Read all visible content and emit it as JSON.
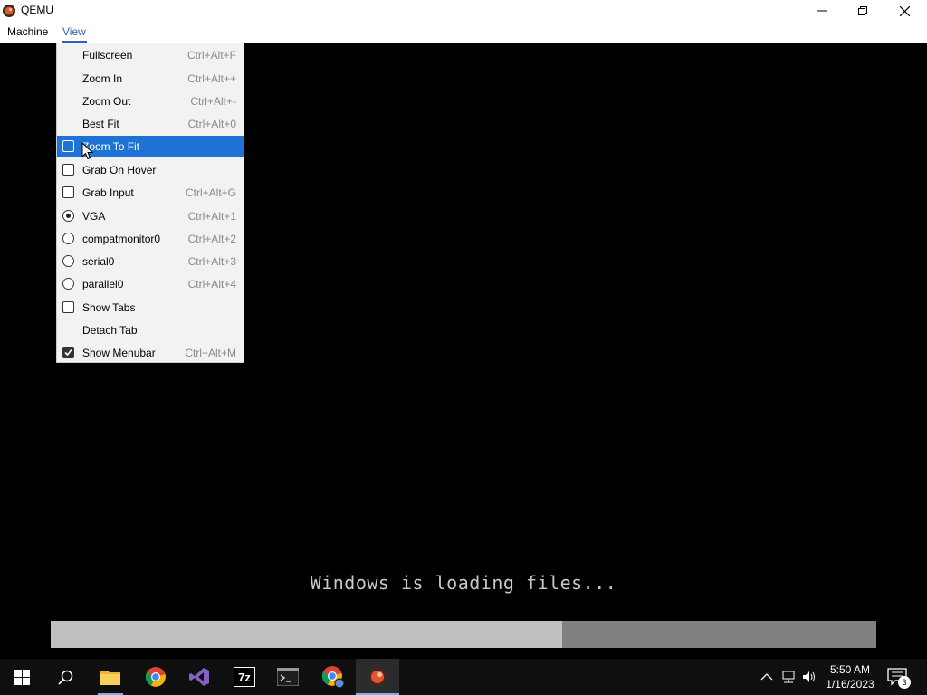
{
  "window": {
    "title": "QEMU",
    "app_icon": "qemu-icon",
    "controls": [
      "minimize-icon",
      "restore-icon",
      "close-icon"
    ]
  },
  "menubar": {
    "items": [
      {
        "label": "Machine"
      },
      {
        "label": "View",
        "active": true
      }
    ]
  },
  "view_menu": {
    "items": [
      {
        "label": "Fullscreen",
        "shortcut": "Ctrl+Alt+F",
        "indicator": "none"
      },
      {
        "label": "Zoom In",
        "shortcut": "Ctrl+Alt++",
        "indicator": "none"
      },
      {
        "label": "Zoom Out",
        "shortcut": "Ctrl+Alt+-",
        "indicator": "none"
      },
      {
        "label": "Best Fit",
        "shortcut": "Ctrl+Alt+0",
        "indicator": "none"
      },
      {
        "label": "Zoom To Fit",
        "shortcut": "",
        "indicator": "checkbox",
        "checked": false,
        "highlighted": true
      },
      {
        "label": "Grab On Hover",
        "shortcut": "",
        "indicator": "checkbox",
        "checked": false
      },
      {
        "label": "Grab Input",
        "shortcut": "Ctrl+Alt+G",
        "indicator": "checkbox",
        "checked": false
      },
      {
        "label": "VGA",
        "shortcut": "Ctrl+Alt+1",
        "indicator": "radio",
        "checked": true
      },
      {
        "label": "compatmonitor0",
        "shortcut": "Ctrl+Alt+2",
        "indicator": "radio",
        "checked": false
      },
      {
        "label": "serial0",
        "shortcut": "Ctrl+Alt+3",
        "indicator": "radio",
        "checked": false
      },
      {
        "label": "parallel0",
        "shortcut": "Ctrl+Alt+4",
        "indicator": "radio",
        "checked": false
      },
      {
        "label": "Show Tabs",
        "shortcut": "",
        "indicator": "checkbox",
        "checked": false
      },
      {
        "label": "Detach Tab",
        "shortcut": "",
        "indicator": "none"
      },
      {
        "label": "Show Menubar",
        "shortcut": "Ctrl+Alt+M",
        "indicator": "checkbox",
        "checked": true
      }
    ]
  },
  "guest_screen": {
    "loading_text": "Windows is loading files...",
    "progress_fraction": 0.62
  },
  "taskbar": {
    "apps": [
      {
        "icon": "windows-start-icon"
      },
      {
        "icon": "search-icon"
      },
      {
        "icon": "file-explorer-icon",
        "running": true
      },
      {
        "icon": "chrome-icon"
      },
      {
        "icon": "visual-studio-icon"
      },
      {
        "icon": "7zip-icon",
        "label": "7z"
      },
      {
        "icon": "terminal-icon"
      },
      {
        "icon": "chrome-profile-icon"
      },
      {
        "icon": "qemu-icon",
        "active": true
      }
    ],
    "tray": [
      "chevron-up-icon",
      "network-icon",
      "volume-icon"
    ],
    "clock": {
      "time": "5:50 AM",
      "date": "1/16/2023"
    },
    "notifications": {
      "icon": "notification-icon",
      "count": "3"
    }
  },
  "colors": {
    "menu_highlight": "#1f72d6",
    "menubar_active": "#2a64b8",
    "progress_fill": "#c0c0c0",
    "progress_track": "#808080"
  }
}
